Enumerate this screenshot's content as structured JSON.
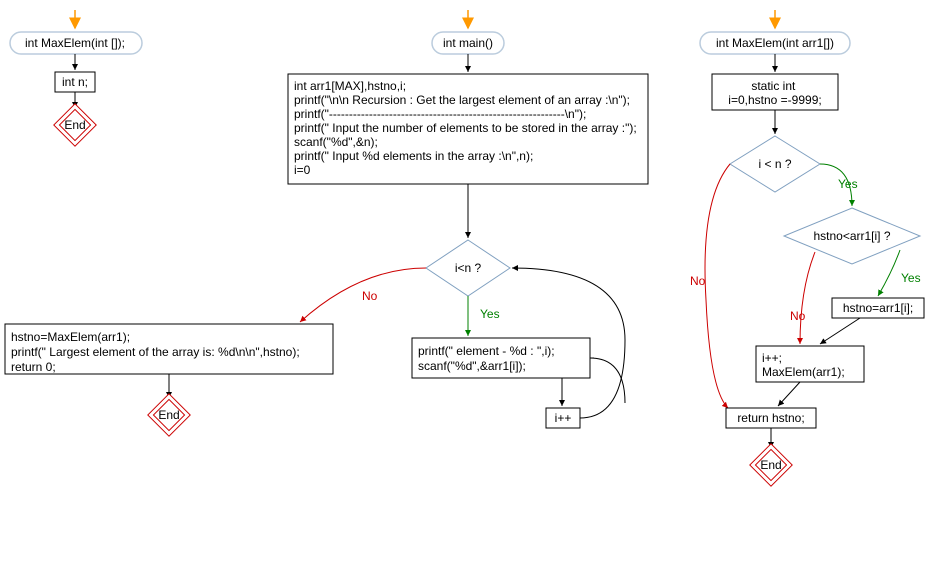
{
  "col1": {
    "funcDecl": "int MaxElem(int []);",
    "intN": "int n;",
    "end": "End"
  },
  "col2": {
    "main": "int main()",
    "block": "int arr1[MAX],hstno,i;\nprintf(\"\\n\\n Recursion : Get the largest element of an array :\\n\");\nprintf(\"-----------------------------------------------------------\\n\");\nprintf(\" Input the number of elements to be stored in the array :\");\nscanf(\"%d\",&n);\nprintf(\" Input %d elements in the array :\\n\",n);\ni=0",
    "cond": "i<n ?",
    "no": "No",
    "yes": "Yes",
    "loopBody": "printf(\" element - %d : \",i);\nscanf(\"%d\",&arr1[i]);",
    "inc": "i++",
    "afterLoop": "hstno=MaxElem(arr1);\nprintf(\" Largest element of the array is: %d\\n\\n\",hstno);\nreturn 0;",
    "end": "End"
  },
  "col3": {
    "func": "int MaxElem(int arr1[])",
    "init": "static int\ni=0,hstno =-9999;",
    "cond1": "i < n ?",
    "cond2": "hstno<arr1[i] ?",
    "assign": "hstno=arr1[i];",
    "recurse": "i++;\nMaxElem(arr1);",
    "ret": "return hstno;",
    "no": "No",
    "yes": "Yes",
    "end": "End"
  }
}
